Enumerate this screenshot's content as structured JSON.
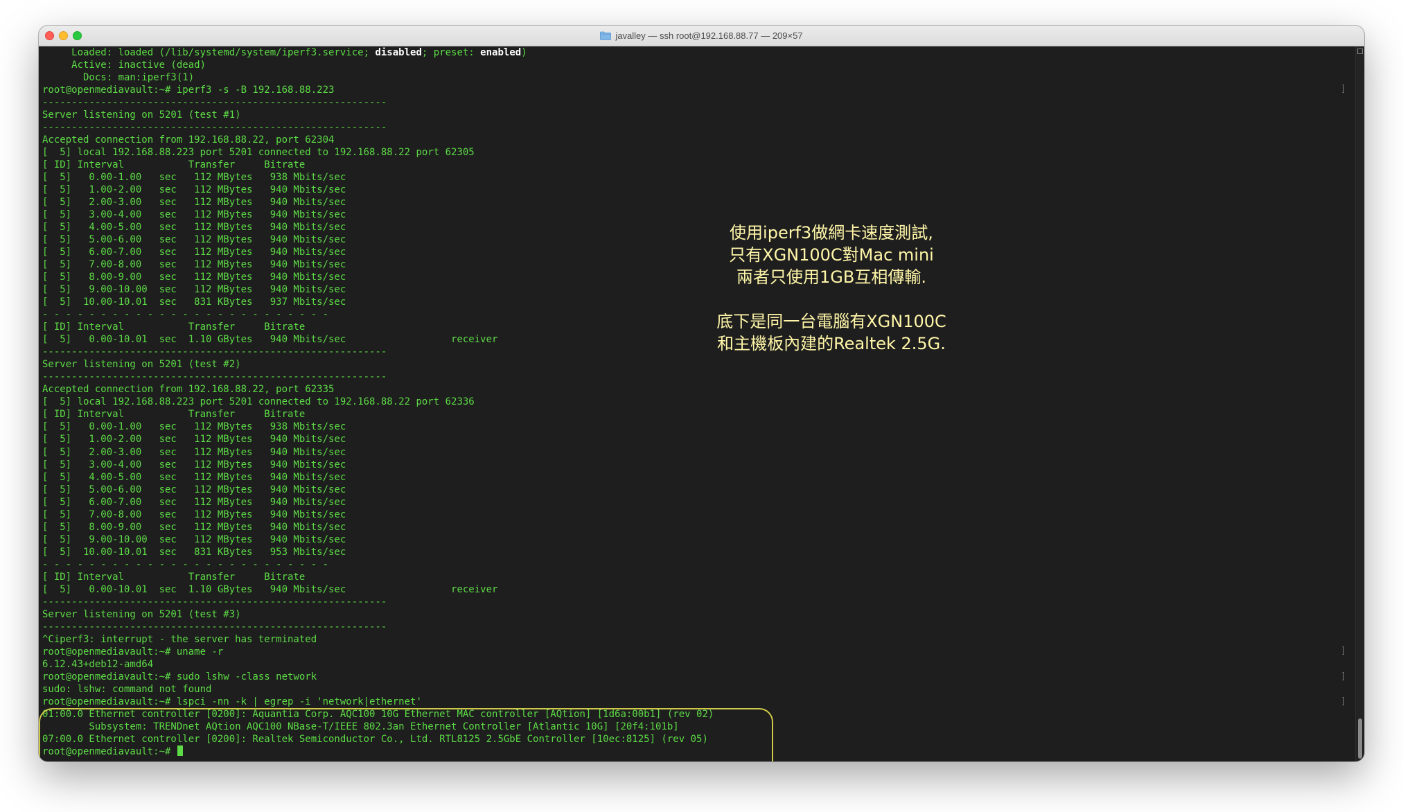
{
  "window": {
    "title": "javalley — ssh root@192.168.88.77 — 209×57"
  },
  "terminal": {
    "lines": [
      {
        "text": "     Loaded: loaded (/lib/systemd/system/iperf3.service; ",
        "bold1": "disabled",
        "mid": "; preset: ",
        "bold2": "enabled",
        "end": ")"
      },
      {
        "text": "     Active: inactive (dead)"
      },
      {
        "text": "       Docs: man:iperf3(1)"
      },
      {
        "text": "root@openmediavault:~# iperf3 -s -B 192.168.88.223",
        "mark": true
      },
      {
        "text": "-----------------------------------------------------------"
      },
      {
        "text": "Server listening on 5201 (test #1)"
      },
      {
        "text": "-----------------------------------------------------------"
      },
      {
        "text": "Accepted connection from 192.168.88.22, port 62304"
      },
      {
        "text": "[  5] local 192.168.88.223 port 5201 connected to 192.168.88.22 port 62305"
      },
      {
        "text": "[ ID] Interval           Transfer     Bitrate"
      },
      {
        "text": "[  5]   0.00-1.00   sec   112 MBytes   938 Mbits/sec"
      },
      {
        "text": "[  5]   1.00-2.00   sec   112 MBytes   940 Mbits/sec"
      },
      {
        "text": "[  5]   2.00-3.00   sec   112 MBytes   940 Mbits/sec"
      },
      {
        "text": "[  5]   3.00-4.00   sec   112 MBytes   940 Mbits/sec"
      },
      {
        "text": "[  5]   4.00-5.00   sec   112 MBytes   940 Mbits/sec"
      },
      {
        "text": "[  5]   5.00-6.00   sec   112 MBytes   940 Mbits/sec"
      },
      {
        "text": "[  5]   6.00-7.00   sec   112 MBytes   940 Mbits/sec"
      },
      {
        "text": "[  5]   7.00-8.00   sec   112 MBytes   940 Mbits/sec"
      },
      {
        "text": "[  5]   8.00-9.00   sec   112 MBytes   940 Mbits/sec"
      },
      {
        "text": "[  5]   9.00-10.00  sec   112 MBytes   940 Mbits/sec"
      },
      {
        "text": "[  5]  10.00-10.01  sec   831 KBytes   937 Mbits/sec"
      },
      {
        "text": "- - - - - - - - - - - - - - - - - - - - - - - - -"
      },
      {
        "text": "[ ID] Interval           Transfer     Bitrate"
      },
      {
        "text": "[  5]   0.00-10.01  sec  1.10 GBytes   940 Mbits/sec                  receiver"
      },
      {
        "text": "-----------------------------------------------------------"
      },
      {
        "text": "Server listening on 5201 (test #2)"
      },
      {
        "text": "-----------------------------------------------------------"
      },
      {
        "text": "Accepted connection from 192.168.88.22, port 62335"
      },
      {
        "text": "[  5] local 192.168.88.223 port 5201 connected to 192.168.88.22 port 62336"
      },
      {
        "text": "[ ID] Interval           Transfer     Bitrate"
      },
      {
        "text": "[  5]   0.00-1.00   sec   112 MBytes   938 Mbits/sec"
      },
      {
        "text": "[  5]   1.00-2.00   sec   112 MBytes   940 Mbits/sec"
      },
      {
        "text": "[  5]   2.00-3.00   sec   112 MBytes   940 Mbits/sec"
      },
      {
        "text": "[  5]   3.00-4.00   sec   112 MBytes   940 Mbits/sec"
      },
      {
        "text": "[  5]   4.00-5.00   sec   112 MBytes   940 Mbits/sec"
      },
      {
        "text": "[  5]   5.00-6.00   sec   112 MBytes   940 Mbits/sec"
      },
      {
        "text": "[  5]   6.00-7.00   sec   112 MBytes   940 Mbits/sec"
      },
      {
        "text": "[  5]   7.00-8.00   sec   112 MBytes   940 Mbits/sec"
      },
      {
        "text": "[  5]   8.00-9.00   sec   112 MBytes   940 Mbits/sec"
      },
      {
        "text": "[  5]   9.00-10.00  sec   112 MBytes   940 Mbits/sec"
      },
      {
        "text": "[  5]  10.00-10.01  sec   831 KBytes   953 Mbits/sec"
      },
      {
        "text": "- - - - - - - - - - - - - - - - - - - - - - - - -"
      },
      {
        "text": "[ ID] Interval           Transfer     Bitrate"
      },
      {
        "text": "[  5]   0.00-10.01  sec  1.10 GBytes   940 Mbits/sec                  receiver"
      },
      {
        "text": "-----------------------------------------------------------"
      },
      {
        "text": "Server listening on 5201 (test #3)"
      },
      {
        "text": "-----------------------------------------------------------"
      },
      {
        "text": "^Ciperf3: interrupt - the server has terminated"
      },
      {
        "text": "root@openmediavault:~# uname -r",
        "mark": true
      },
      {
        "text": "6.12.43+deb12-amd64"
      },
      {
        "text": "root@openmediavault:~# sudo lshw -class network",
        "mark": true
      },
      {
        "text": "sudo: lshw: command not found"
      },
      {
        "text": "root@openmediavault:~# lspci -nn -k | egrep -i 'network|ethernet'",
        "mark": true
      },
      {
        "text": "01:00.0 Ethernet controller [0200]: Aquantia Corp. AQC100 10G Ethernet MAC controller [AQtion] [1d6a:00b1] (rev 02)"
      },
      {
        "text": "        Subsystem: TRENDnet AQtion AQC100 NBase-T/IEEE 802.3an Ethernet Controller [Atlantic 10G] [20f4:101b]"
      },
      {
        "text": "07:00.0 Ethernet controller [0200]: Realtek Semiconductor Co., Ltd. RTL8125 2.5GbE Controller [10ec:8125] (rev 05)"
      },
      {
        "text": "root@openmediavault:~# ",
        "cursor": true
      }
    ]
  },
  "annotation": {
    "block1": [
      "使用iperf3做網卡速度測試,",
      "只有XGN100C對Mac mini",
      "兩者只使用1GB互相傳輸."
    ],
    "block2": [
      "底下是同一台電腦有XGN100C",
      "和主機板內建的Realtek 2.5G."
    ]
  },
  "colors": {
    "terminal_bg": "#1e1e1e",
    "terminal_text": "#5ddb46",
    "annotation_text": "#fff6a8",
    "highlight_border": "#cfc84a"
  }
}
